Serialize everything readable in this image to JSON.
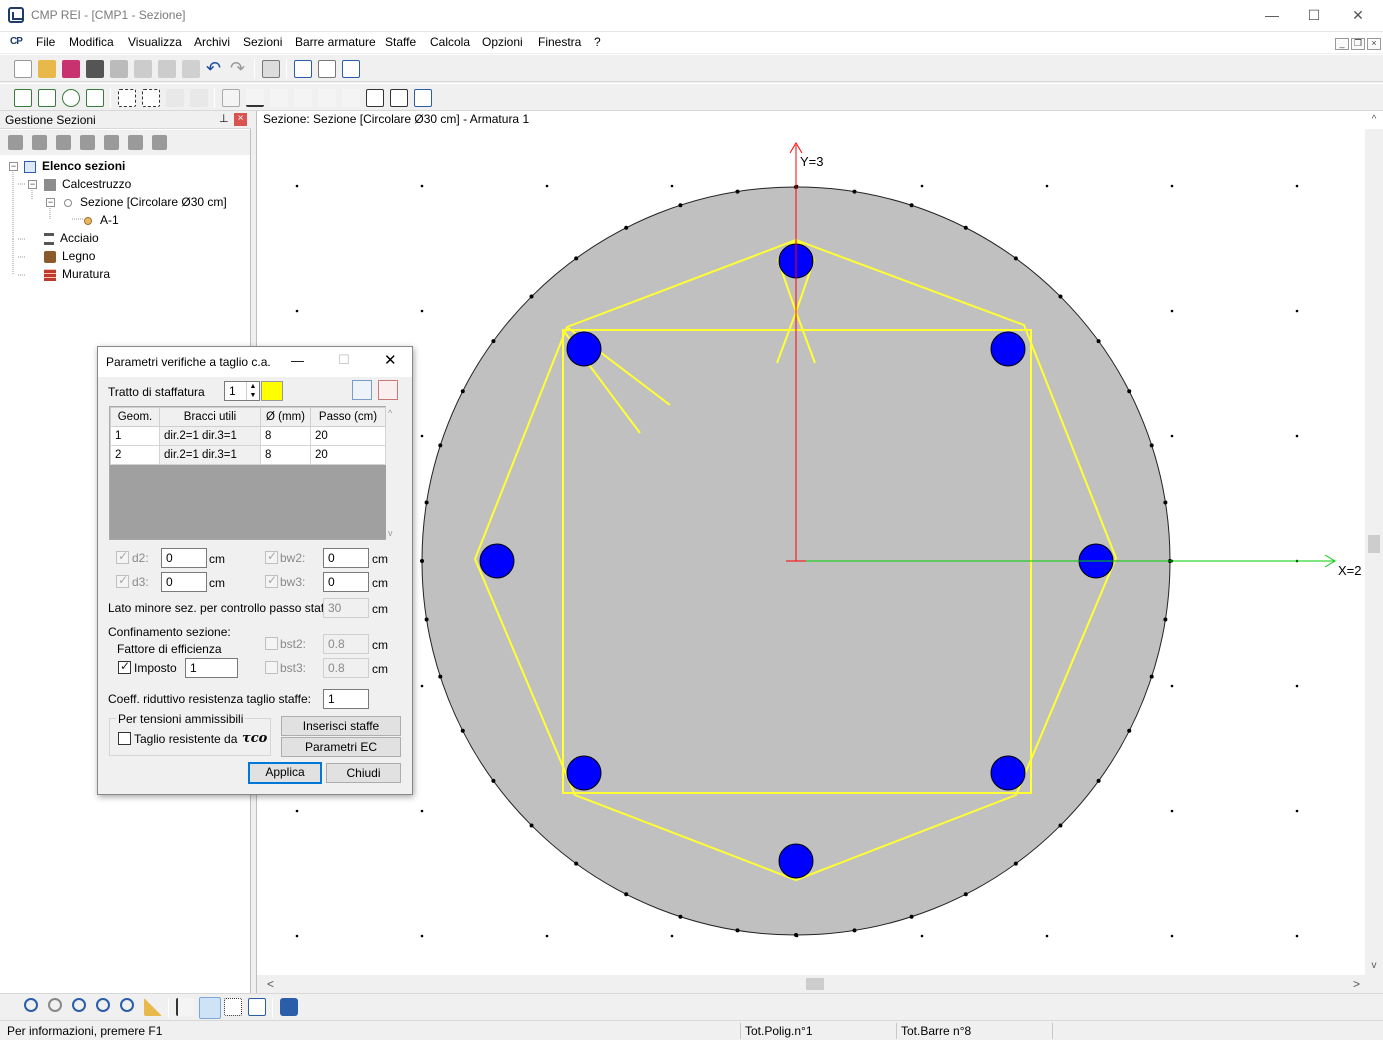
{
  "window": {
    "title": "CMP REI - [CMP1 - Sezione]",
    "minimize": "—",
    "maximize": "☐",
    "close": "✕"
  },
  "menu": {
    "logo": "CP",
    "items": [
      "File",
      "Modifica",
      "Visualizza",
      "Archivi",
      "Sezioni",
      "Barre armature",
      "Staffe",
      "Calcola",
      "Opzioni",
      "Finestra",
      "?"
    ]
  },
  "left_panel": {
    "title": "Gestione Sezioni",
    "tree": {
      "root": "Elenco sezioni",
      "calcestruzzo": "Calcestruzzo",
      "sezione": "Sezione [Circolare Ø30 cm]",
      "armatura": "A-1",
      "acciaio": "Acciaio",
      "legno": "Legno",
      "muratura": "Muratura"
    }
  },
  "canvas": {
    "caption": "Sezione: Sezione [Circolare Ø30 cm] - Armatura 1",
    "y_axis_label": "Y=3",
    "x_axis_label": "X=2",
    "section_diameter_cm": 30,
    "bars_count": 8,
    "colors": {
      "concrete": "#c0c0c0",
      "bar": "#0000ff",
      "stirrup": "#ffff33",
      "x_axis": "#00cc00",
      "y_axis": "#ff0000"
    }
  },
  "dialog": {
    "title": "Parametri verifiche a taglio c.a.",
    "tratto_label": "Tratto di staffatura",
    "tratto_value": "1",
    "tratto_color": "#ffff00",
    "table": {
      "headers": [
        "Geom.",
        "Bracci utili",
        "Ø (mm)",
        "Passo (cm)"
      ],
      "rows": [
        [
          "1",
          "dir.2=1 dir.3=1",
          "8",
          "20"
        ],
        [
          "2",
          "dir.2=1 dir.3=1",
          "8",
          "20"
        ]
      ]
    },
    "d2_label": "d2:",
    "d2_value": "0",
    "d2_unit": "cm",
    "d3_label": "d3:",
    "d3_value": "0",
    "d3_unit": "cm",
    "bw2_label": "bw2:",
    "bw2_value": "0",
    "bw2_unit": "cm",
    "bw3_label": "bw3:",
    "bw3_value": "0",
    "bw3_unit": "cm",
    "lato_label": "Lato minore sez. per controllo passo staffe:",
    "lato_value": "30",
    "lato_unit": "cm",
    "confinamento_label": "Confinamento sezione:",
    "fattore_label": "Fattore di efficienza",
    "imposto_label": "Imposto",
    "imposto_value": "1",
    "bst2_label": "bst2:",
    "bst2_value": "0.8",
    "bst2_unit": "cm",
    "bst3_label": "bst3:",
    "bst3_value": "0.8",
    "bst3_unit": "cm",
    "coeff_label": "Coeff. riduttivo resistenza taglio staffe:",
    "coeff_value": "1",
    "tensioni_label": "Per tensioni ammissibili",
    "taglio_label": "Taglio resistente da",
    "tau_label": "τco",
    "inserisci_label": "Inserisci staffe",
    "parametri_label": "Parametri EC",
    "applica_label": "Applica",
    "chiudi_label": "Chiudi"
  },
  "status": {
    "info": "Per informazioni, premere F1",
    "poligoni": "Tot.Polig.n°1",
    "barre": "Tot.Barre n°8"
  }
}
